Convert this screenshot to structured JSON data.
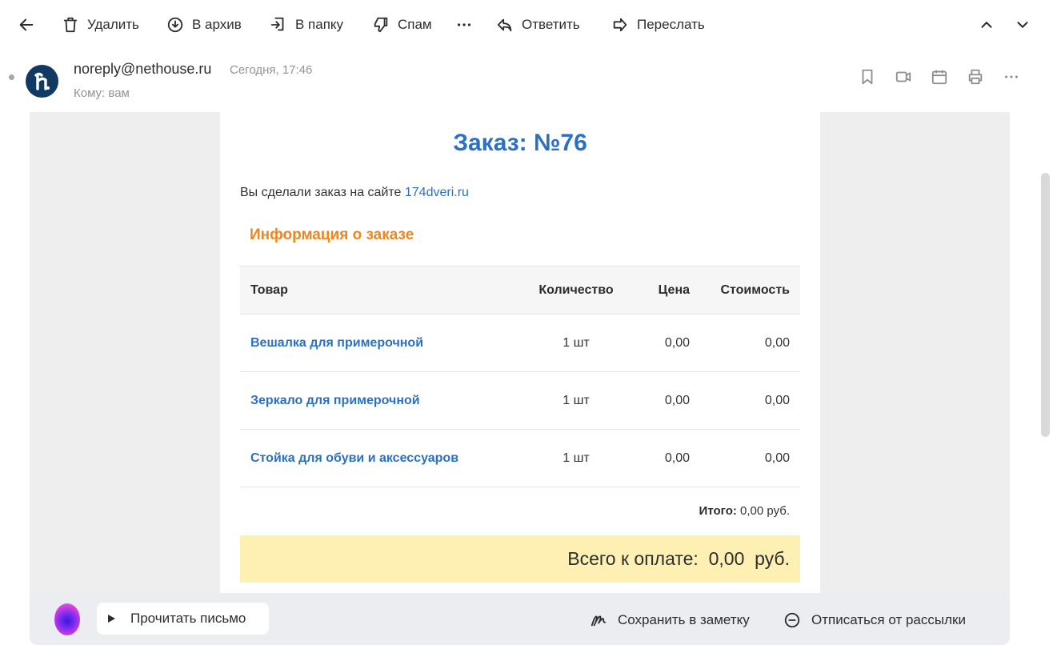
{
  "toolbar": {
    "back_icon": "arrow-left-icon",
    "delete_label": "Удалить",
    "archive_label": "В архив",
    "folder_label": "В папку",
    "spam_label": "Спам",
    "reply_label": "Ответить",
    "forward_label": "Переслать"
  },
  "message": {
    "sender": "noreply@nethouse.ru",
    "date": "Сегодня, 17:46",
    "to": "Кому: вам",
    "header_icons": [
      "bookmark-icon",
      "video-icon",
      "calendar-icon",
      "print-icon",
      "more-icon"
    ]
  },
  "order": {
    "title": "Заказ: №76",
    "intro_text": "Вы сделали заказ на сайте ",
    "site_link": "174dveri.ru",
    "section_title": "Информация о заказе",
    "columns": [
      "Товар",
      "Количество",
      "Цена",
      "Стоимость"
    ],
    "rows": [
      {
        "name": "Вешалка для примерочной",
        "qty": "1 шт",
        "price": "0,00",
        "cost": "0,00"
      },
      {
        "name": "Зеркало для примерочной",
        "qty": "1 шт",
        "price": "0,00",
        "cost": "0,00"
      },
      {
        "name": "Стойка для обуви и аксессуаров",
        "qty": "1 шт",
        "price": "0,00",
        "cost": "0,00"
      }
    ],
    "total_label": "Итого:",
    "total_value": " 0,00 руб.",
    "pay_text": "Всего к оплате:  0,00  руб."
  },
  "bottom_bar": {
    "read_label": "Прочитать письмо",
    "note_label": "Сохранить в заметку",
    "unsubscribe_label": "Отписаться от рассылки"
  },
  "colors": {
    "link": "#2a70c6",
    "section": "#f0851e",
    "pay_bg": "#fdf0b2",
    "avatar_bg": "#113a63"
  }
}
